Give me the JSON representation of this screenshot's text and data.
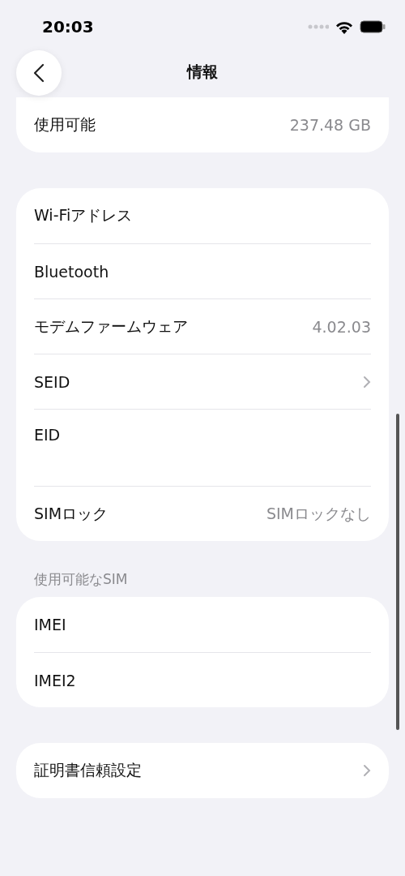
{
  "status_bar": {
    "time": "20:03"
  },
  "nav": {
    "title": "情報"
  },
  "groups": [
    {
      "partial": true,
      "rows": [
        {
          "kind": "value",
          "label": "使用可能",
          "value": "237.48 GB"
        }
      ]
    },
    {
      "rows": [
        {
          "kind": "plain",
          "label": "Wi-Fiアドレス"
        },
        {
          "kind": "plain",
          "label": "Bluetooth"
        },
        {
          "kind": "value",
          "label": "モデムファームウェア",
          "value": "4.02.03"
        },
        {
          "kind": "link",
          "label": "SEID"
        },
        {
          "kind": "detail",
          "label": "EID"
        },
        {
          "kind": "value",
          "label": "SIMロック",
          "value": "SIMロックなし"
        }
      ]
    },
    {
      "header": "使用可能なSIM",
      "rows": [
        {
          "kind": "plain",
          "label": "IMEI"
        },
        {
          "kind": "plain",
          "label": "IMEI2"
        }
      ]
    },
    {
      "rows": [
        {
          "kind": "link",
          "label": "証明書信頼設定"
        }
      ]
    }
  ]
}
